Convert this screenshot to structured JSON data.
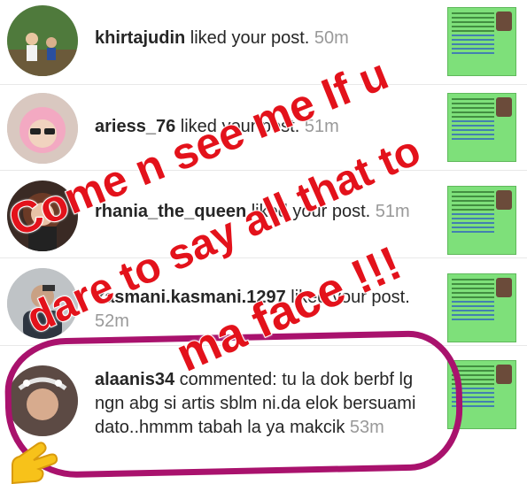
{
  "feed": {
    "items": [
      {
        "username": "khirtajudin",
        "action": " liked your post. ",
        "time": "50m"
      },
      {
        "username": "ariess_76",
        "action": " liked your post. ",
        "time": "51m"
      },
      {
        "username": "rhania_the_queen",
        "action": " liked your post. ",
        "time": "51m"
      },
      {
        "username": "kasmani.kasmani.1297",
        "action": " liked your post. ",
        "time": "52m"
      },
      {
        "username": "alaanis34",
        "action": " commented: tu la dok berbf lg ngn abg si artis sblm ni.da elok bersuami dato..hmmm tabah la ya makcik ",
        "time": "53m"
      }
    ]
  },
  "overlay": {
    "line1": "Come n see me If u",
    "line2": "dare to say all that to",
    "line3": "ma face !!!"
  },
  "colors": {
    "overlay_text": "#e3121b",
    "circle": "#a9126d",
    "thumbnail": "#7ee07a"
  }
}
